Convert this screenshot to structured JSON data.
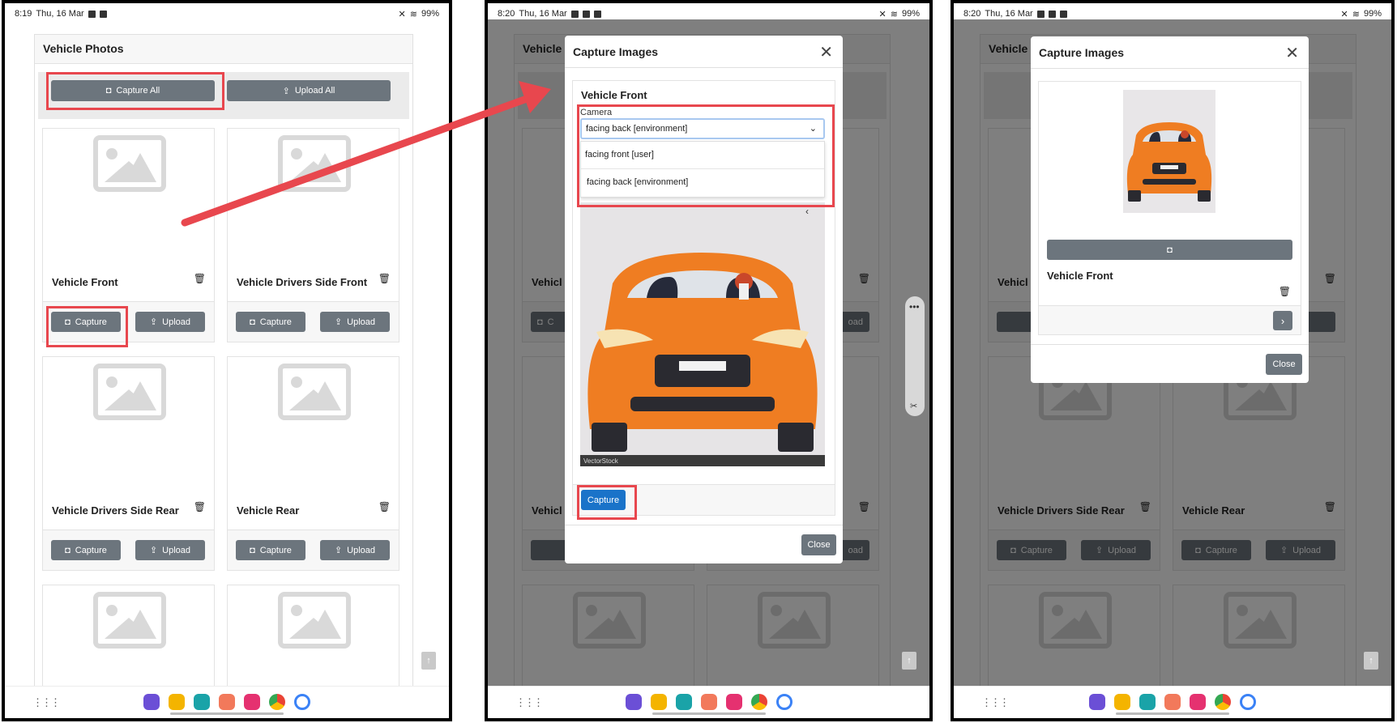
{
  "colors": {
    "accent": "#e8474e",
    "grey_button": "#6c757d",
    "primary": "#1a73c9"
  },
  "frame1": {
    "status_time": "8:19",
    "status_date": "Thu, 16 Mar",
    "battery": "99%",
    "page_title": "Vehicle Photos",
    "capture_all": "Capture All",
    "upload_all": "Upload All",
    "cards": [
      {
        "title": "Vehicle Front",
        "capture": "Capture",
        "upload": "Upload"
      },
      {
        "title": "Vehicle Drivers Side Front",
        "capture": "Capture",
        "upload": "Upload"
      },
      {
        "title": "Vehicle Drivers Side Rear",
        "capture": "Capture",
        "upload": "Upload"
      },
      {
        "title": "Vehicle Rear",
        "capture": "Capture",
        "upload": "Upload"
      }
    ]
  },
  "frame2": {
    "status_time": "8:20",
    "status_date": "Thu, 16 Mar",
    "battery": "99%",
    "bg_title_fragment": "Vehicle F",
    "bg_card_fragment1": "Vehicl",
    "bg_card_fragment2": "Vehicl",
    "bg_capture_fragment": "C",
    "bg_upload_fragment": "oad",
    "modal_title": "Capture Images",
    "section_title": "Vehicle Front",
    "camera_label": "Camera",
    "camera_selected": "facing back [environment]",
    "camera_options": [
      "facing front [user]",
      "facing back [environment]"
    ],
    "watermark": "VectorStock",
    "capture_button": "Capture",
    "close_button": "Close"
  },
  "frame3": {
    "status_time": "8:20",
    "status_date": "Thu, 16 Mar",
    "battery": "99%",
    "bg_title_fragment": "Vehicle P",
    "bg_card_fragment": "Vehicl",
    "modal_title": "Capture Images",
    "section_title": "Vehicle Front",
    "close_button": "Close",
    "bg_cards": [
      {
        "title": "Vehicle Drivers Side Rear",
        "capture": "Capture",
        "upload": "Upload"
      },
      {
        "title": "Vehicle Rear",
        "capture": "Capture",
        "upload": "Upload"
      }
    ]
  },
  "icons": {
    "camera": "camera-icon",
    "upload": "upload-icon",
    "trash": "trash-icon",
    "close": "close-icon",
    "chevron_right": "chevron-right-icon",
    "chevron_down": "chevron-down-icon"
  }
}
